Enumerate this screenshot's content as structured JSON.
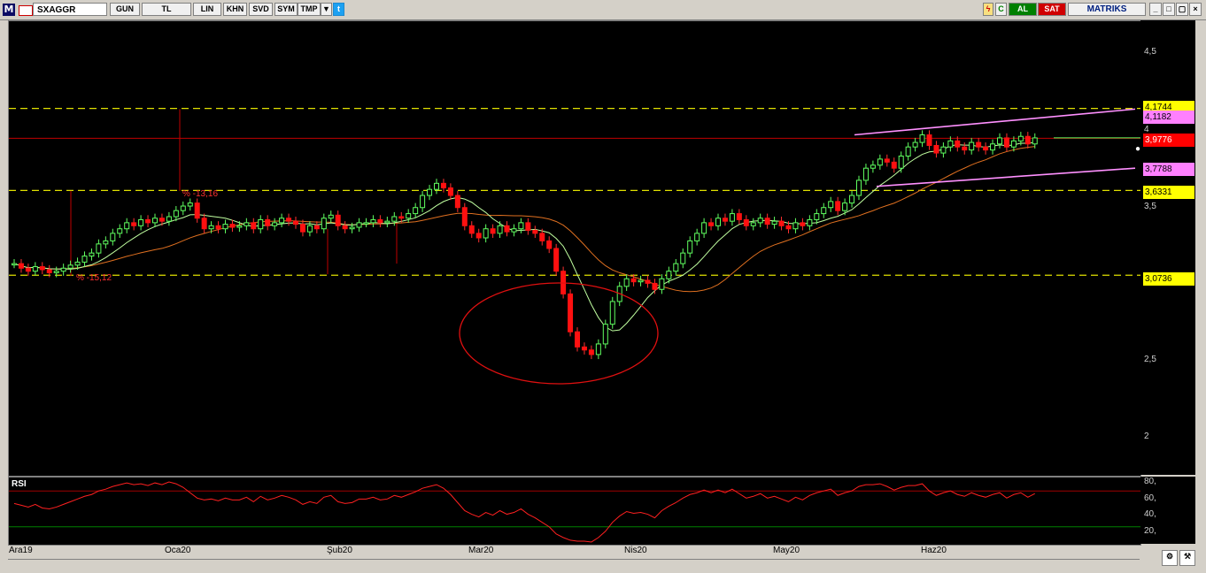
{
  "toolbar": {
    "logo": "M",
    "symbol": "SXAGGR",
    "period_btn": "GUN",
    "currency_btn": "TL",
    "lin_btn": "LIN",
    "khn_btn": "KHN",
    "svd_btn": "SVD",
    "sym_btn": "SYM",
    "tmp_btn": "TMP",
    "buy_btn": "AL",
    "sell_btn": "SAT",
    "brand": "MATRIKS",
    "colors": {
      "buy": "#008000",
      "sell": "#d00000",
      "brand": "#002080"
    }
  },
  "price_axis": {
    "ticks": [
      "4,5",
      "4",
      "3,5",
      "2,5",
      "2"
    ],
    "boxes": [
      {
        "label": "4,1744",
        "bg": "#ffff00",
        "fg": "#000000"
      },
      {
        "label": "4,1182",
        "bg": "#ff80ff",
        "fg": "#000000"
      },
      {
        "label": "3,9776",
        "bg": "#ff0000",
        "fg": "#ffffff"
      },
      {
        "label": "3,7788",
        "bg": "#ff80ff",
        "fg": "#000000"
      },
      {
        "label": "3,6331",
        "bg": "#ffff00",
        "fg": "#000000"
      },
      {
        "label": "3,0736",
        "bg": "#ffff00",
        "fg": "#000000"
      }
    ]
  },
  "annotations": {
    "pct1": "% -13,16",
    "pct2": "% -15,12"
  },
  "rsi": {
    "label": "RSI",
    "ticks": [
      "80,",
      "60,",
      "40,",
      "20,"
    ]
  },
  "x_axis": {
    "labels": [
      "Ara19",
      "Oca20",
      "Şub20",
      "Mar20",
      "Nis20",
      "May20",
      "Haz20"
    ]
  },
  "chart_data": {
    "type": "line",
    "series_type": "candlestick",
    "symbol": "SXAGGR",
    "ylim": [
      1.75,
      4.75
    ],
    "horizontal_levels": [
      4.1744,
      3.6331,
      3.0736,
      3.9776
    ],
    "x_labels": [
      "Ara19",
      "Oca20",
      "Şub20",
      "Mar20",
      "Nis20",
      "May20",
      "Haz20"
    ],
    "close": [
      3.15,
      3.12,
      3.1,
      3.13,
      3.11,
      3.09,
      3.1,
      3.12,
      3.14,
      3.16,
      3.2,
      3.22,
      3.28,
      3.3,
      3.35,
      3.38,
      3.42,
      3.4,
      3.44,
      3.42,
      3.45,
      3.43,
      3.46,
      3.5,
      3.53,
      3.55,
      3.45,
      3.38,
      3.4,
      3.38,
      3.41,
      3.39,
      3.4,
      3.42,
      3.38,
      3.44,
      3.4,
      3.42,
      3.45,
      3.43,
      3.41,
      3.36,
      3.4,
      3.38,
      3.45,
      3.47,
      3.4,
      3.38,
      3.39,
      3.42,
      3.42,
      3.44,
      3.42,
      3.43,
      3.46,
      3.45,
      3.48,
      3.52,
      3.6,
      3.64,
      3.68,
      3.65,
      3.6,
      3.52,
      3.4,
      3.35,
      3.32,
      3.38,
      3.35,
      3.4,
      3.36,
      3.38,
      3.42,
      3.37,
      3.35,
      3.3,
      3.25,
      3.1,
      2.95,
      2.7,
      2.6,
      2.58,
      2.55,
      2.62,
      2.75,
      2.9,
      3.0,
      3.05,
      3.03,
      3.04,
      3.02,
      2.98,
      3.05,
      3.1,
      3.15,
      3.22,
      3.3,
      3.35,
      3.42,
      3.4,
      3.45,
      3.43,
      3.48,
      3.44,
      3.4,
      3.42,
      3.45,
      3.41,
      3.43,
      3.4,
      3.38,
      3.42,
      3.4,
      3.44,
      3.48,
      3.52,
      3.56,
      3.5,
      3.55,
      3.6,
      3.7,
      3.78,
      3.8,
      3.84,
      3.82,
      3.78,
      3.86,
      3.92,
      3.95,
      4.0,
      3.93,
      3.88,
      3.92,
      3.96,
      3.92,
      3.9,
      3.95,
      3.92,
      3.9,
      3.94,
      3.98,
      3.92,
      3.96,
      3.99,
      3.94,
      3.98
    ],
    "rsi": [
      56,
      54,
      52,
      55,
      51,
      50,
      52,
      55,
      58,
      61,
      64,
      66,
      70,
      72,
      75,
      77,
      79,
      77,
      78,
      76,
      79,
      77,
      80,
      78,
      74,
      68,
      62,
      60,
      61,
      59,
      62,
      60,
      60,
      63,
      58,
      64,
      60,
      62,
      65,
      63,
      60,
      55,
      58,
      56,
      63,
      65,
      58,
      56,
      57,
      61,
      61,
      63,
      60,
      61,
      65,
      63,
      66,
      69,
      73,
      75,
      77,
      73,
      66,
      57,
      48,
      44,
      41,
      46,
      43,
      48,
      44,
      46,
      50,
      44,
      40,
      35,
      30,
      22,
      18,
      15,
      14,
      14,
      13,
      18,
      25,
      35,
      42,
      47,
      45,
      46,
      44,
      40,
      48,
      53,
      57,
      62,
      66,
      68,
      71,
      68,
      71,
      68,
      72,
      67,
      62,
      64,
      67,
      62,
      64,
      61,
      58,
      63,
      60,
      65,
      68,
      70,
      72,
      65,
      68,
      70,
      75,
      77,
      77,
      78,
      75,
      71,
      74,
      76,
      76,
      78,
      70,
      65,
      68,
      70,
      66,
      64,
      68,
      65,
      63,
      66,
      68,
      62,
      66,
      68,
      63,
      67
    ]
  }
}
